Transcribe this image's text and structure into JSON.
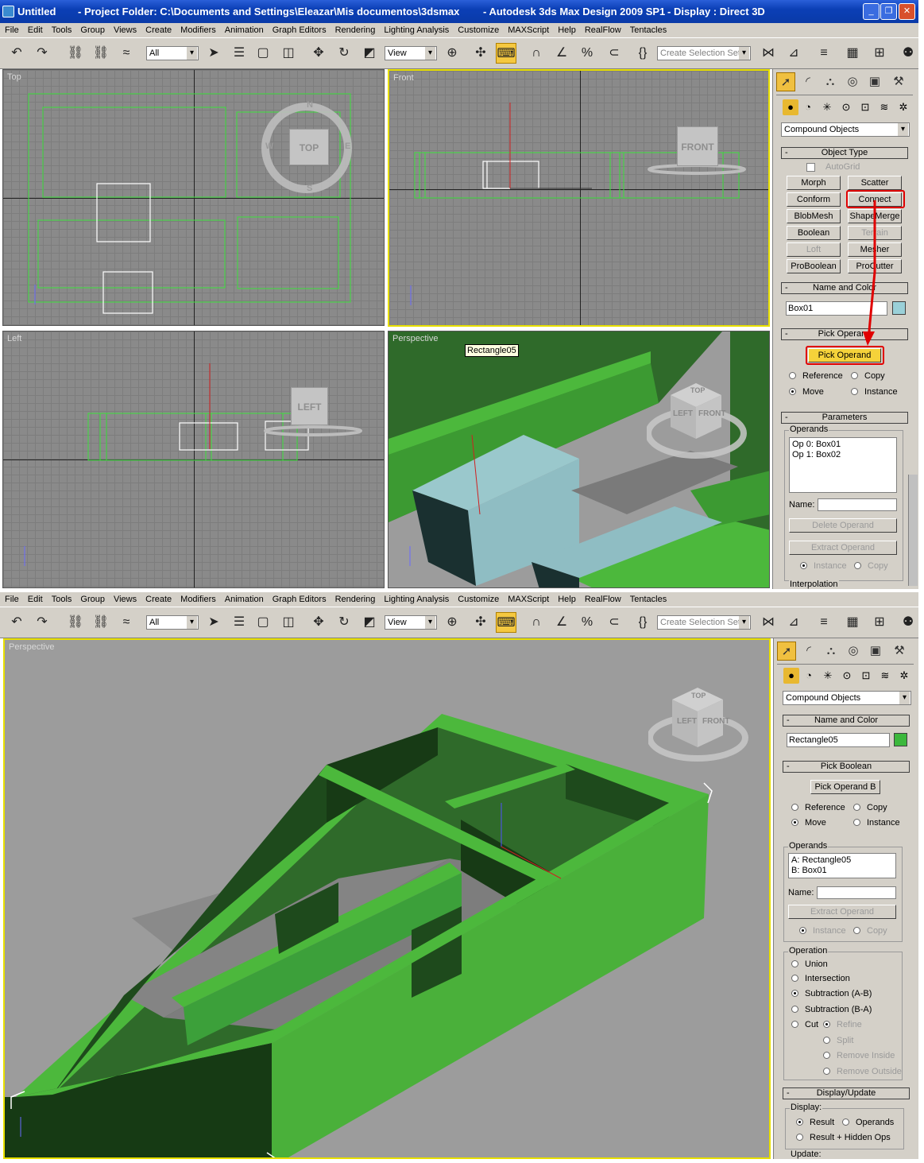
{
  "title": {
    "app_icon": "max-icon",
    "doc": "Untitled",
    "project": "- Project Folder: C:\\Documents and Settings\\Eleazar\\Mis documentos\\3dsmax",
    "product": "- Autodesk 3ds Max Design 2009 SP1",
    "display": "- Display : Direct 3D"
  },
  "menu": [
    "File",
    "Edit",
    "Tools",
    "Group",
    "Views",
    "Create",
    "Modifiers",
    "Animation",
    "Graph Editors",
    "Rendering",
    "Lighting Analysis",
    "Customize",
    "MAXScript",
    "Help",
    "RealFlow",
    "Tentacles"
  ],
  "toolbar": {
    "filter": "All",
    "ref_coord": "View",
    "selection_set": "Create Selection Set"
  },
  "top": {
    "viewports": {
      "top": "Top",
      "front": "Front",
      "left": "Left",
      "perspective": "Perspective"
    },
    "cubes": {
      "top": "TOP",
      "front": "FRONT",
      "left": "LEFT",
      "persp_top": "TOP",
      "persp_left": "LEFT",
      "persp_front": "FRONT"
    },
    "compass": {
      "n": "N",
      "s": "S",
      "e": "E",
      "w": "W"
    },
    "tooltip": "Rectangle05",
    "panel": {
      "category": "Compound Objects",
      "object_type": "Object Type",
      "autogrid": "AutoGrid",
      "buttons": [
        "Morph",
        "Scatter",
        "Conform",
        "Connect",
        "BlobMesh",
        "ShapeMerge",
        "Boolean",
        "Terrain",
        "Loft",
        "Mesher",
        "ProBoolean",
        "ProCutter"
      ],
      "name_color": "Name and Color",
      "name_value": "Box01",
      "swatch_color": "#9ad0d8",
      "pick_operand_hdr": "Pick Operand",
      "pick_operand_btn": "Pick Operand",
      "reference": "Reference",
      "copy": "Copy",
      "move": "Move",
      "instance": "Instance",
      "parameters": "Parameters",
      "operands_label": "Operands",
      "operands": [
        "Op 0: Box01",
        "Op 1: Box02"
      ],
      "name_label": "Name:",
      "delete_operand": "Delete Operand",
      "extract_operand": "Extract Operand",
      "instance2": "Instance",
      "copy2": "Copy",
      "interpolation": "Interpolation"
    }
  },
  "bottom": {
    "viewport": "Perspective",
    "cube": {
      "top": "TOP",
      "left": "LEFT",
      "front": "FRONT"
    },
    "panel": {
      "category": "Compound Objects",
      "name_color": "Name and Color",
      "name_value": "Rectangle05",
      "swatch_color": "#3cb83c",
      "pick_boolean": "Pick Boolean",
      "pick_operand_b": "Pick Operand B",
      "reference": "Reference",
      "copy": "Copy",
      "move": "Move",
      "instance": "Instance",
      "operands_label": "Operands",
      "operands": [
        "A: Rectangle05",
        "B: Box01"
      ],
      "name_label": "Name:",
      "extract_operand": "Extract Operand",
      "instance2": "Instance",
      "copy2": "Copy",
      "operation": "Operation",
      "union": "Union",
      "intersection": "Intersection",
      "sub_ab": "Subtraction (A-B)",
      "sub_ba": "Subtraction (B-A)",
      "cut": "Cut",
      "refine": "Refine",
      "split": "Split",
      "remove_inside": "Remove Inside",
      "remove_outside": "Remove Outside",
      "display_update": "Display/Update",
      "display": "Display:",
      "result": "Result",
      "operands_opt": "Operands",
      "result_hidden": "Result + Hidden Ops",
      "update": "Update:"
    }
  },
  "colors": {
    "accent": "#f5d23a",
    "highlight": "#e00000",
    "object_green": "#4caf3c",
    "box_blue": "#8fbdc3"
  }
}
